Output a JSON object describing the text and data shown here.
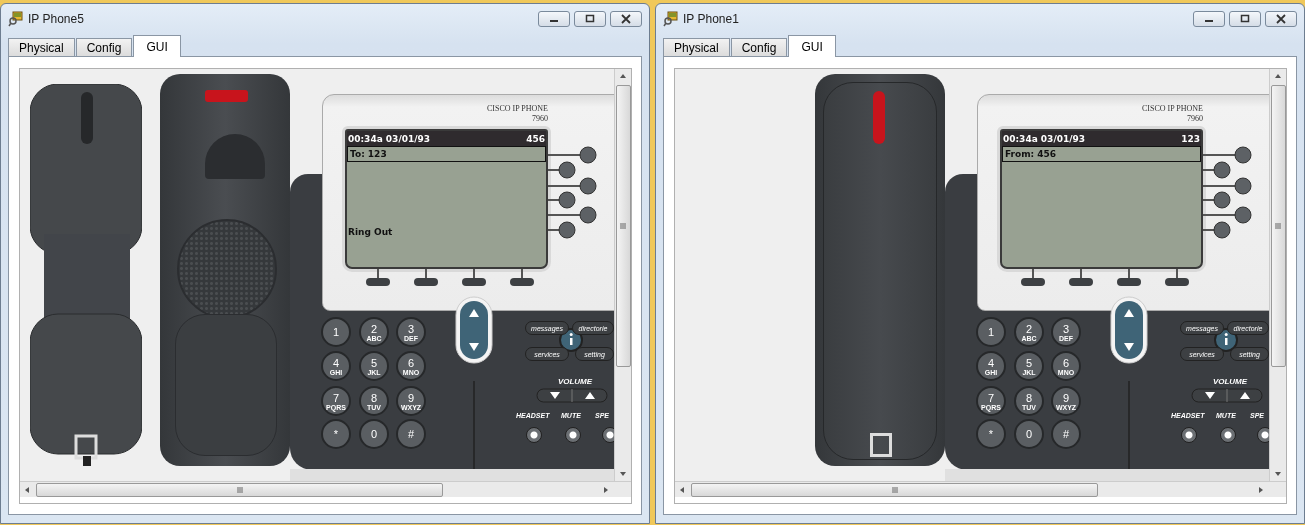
{
  "windows": [
    {
      "title": "IP Phone5",
      "tabs": [
        {
          "label": "Physical",
          "selected": false
        },
        {
          "label": "Config",
          "selected": false
        },
        {
          "label": "GUI",
          "selected": true
        }
      ],
      "phone": {
        "off_hook": true,
        "brand": "CISCO IP PHONE",
        "model": "7960",
        "screen": {
          "time": "00:34a 03/01/93",
          "line": "456",
          "header": "To: 123",
          "status": "Ring Out"
        },
        "keys": [
          {
            "digit": "1"
          },
          {
            "digit": "2",
            "letters": "ABC"
          },
          {
            "digit": "3",
            "letters": "DEF"
          },
          {
            "digit": "4",
            "letters": "GHI"
          },
          {
            "digit": "5",
            "letters": "JKL"
          },
          {
            "digit": "6",
            "letters": "MNO"
          },
          {
            "digit": "7",
            "letters": "PQRS"
          },
          {
            "digit": "8",
            "letters": "TUV"
          },
          {
            "digit": "9",
            "letters": "WXYZ"
          },
          {
            "digit": "*"
          },
          {
            "digit": "0"
          },
          {
            "digit": "#"
          }
        ],
        "feature_keys": [
          "messages",
          "directorie",
          "services",
          "setting"
        ],
        "volume_label": "VOLUME",
        "bottom_buttons": [
          "HEADSET",
          "MUTE",
          "SPE"
        ]
      }
    },
    {
      "title": "IP Phone1",
      "tabs": [
        {
          "label": "Physical",
          "selected": false
        },
        {
          "label": "Config",
          "selected": false
        },
        {
          "label": "GUI",
          "selected": true
        }
      ],
      "phone": {
        "off_hook": false,
        "brand": "CISCO IP PHONE",
        "model": "7960",
        "screen": {
          "time": "00:34a 03/01/93",
          "line": "123",
          "header": "From: 456"
        },
        "keys": [
          {
            "digit": "1"
          },
          {
            "digit": "2",
            "letters": "ABC"
          },
          {
            "digit": "3",
            "letters": "DEF"
          },
          {
            "digit": "4",
            "letters": "GHI"
          },
          {
            "digit": "5",
            "letters": "JKL"
          },
          {
            "digit": "6",
            "letters": "MNO"
          },
          {
            "digit": "7",
            "letters": "PQRS"
          },
          {
            "digit": "8",
            "letters": "TUV"
          },
          {
            "digit": "9",
            "letters": "WXYZ"
          },
          {
            "digit": "*"
          },
          {
            "digit": "0"
          },
          {
            "digit": "#"
          }
        ],
        "feature_keys": [
          "messages",
          "directorie",
          "services",
          "setting"
        ],
        "volume_label": "VOLUME",
        "bottom_buttons": [
          "HEADSET",
          "MUTE",
          "SPE"
        ]
      }
    }
  ]
}
